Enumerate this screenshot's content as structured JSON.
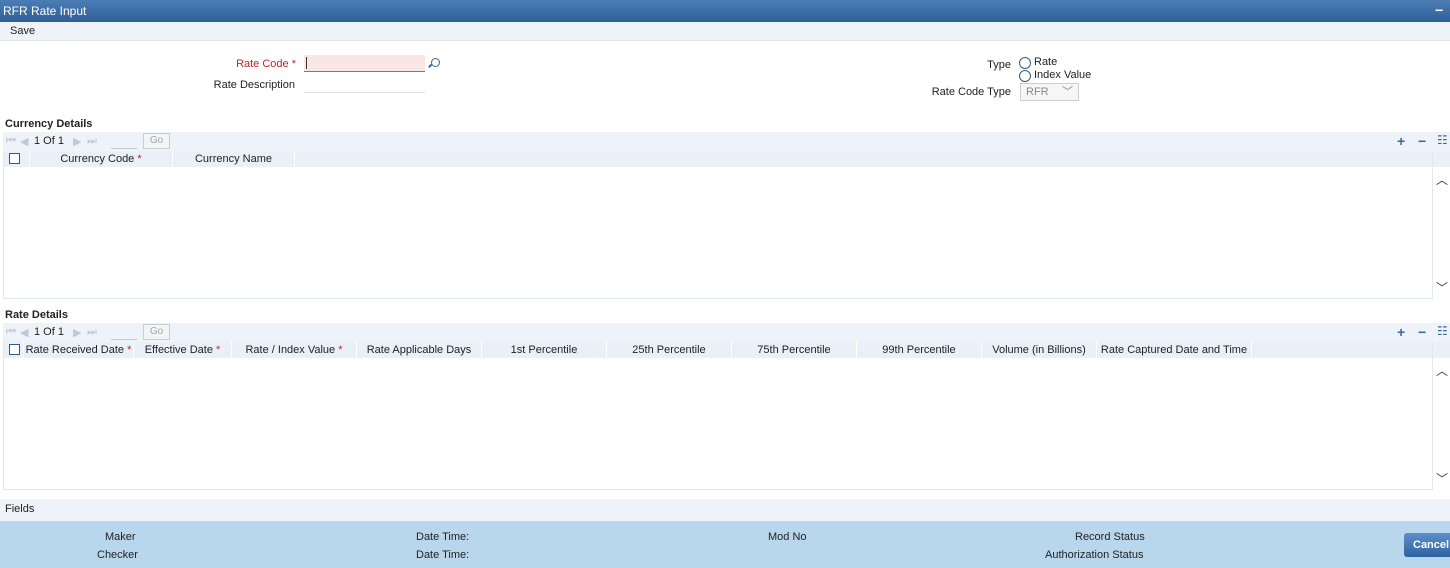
{
  "window": {
    "title": "RFR Rate Input",
    "minimize_glyph": "−"
  },
  "toolbar": {
    "save_label": "Save"
  },
  "form": {
    "rate_code_label": "Rate Code",
    "required_mark": "*",
    "rate_code_value": "",
    "rate_description_label": "Rate Description",
    "rate_description_value": "",
    "type_label": "Type",
    "type_options": [
      "Rate",
      "Index Value"
    ],
    "rate_code_type_label": "Rate Code Type",
    "rate_code_type_value": "RFR"
  },
  "currency_details": {
    "title": "Currency Details",
    "pager": {
      "text": "1 Of 1",
      "go_label": "Go"
    },
    "columns": [
      "Currency Code",
      "Currency Name"
    ],
    "rows": []
  },
  "rate_details": {
    "title": "Rate Details",
    "pager": {
      "text": "1 Of 1",
      "go_label": "Go"
    },
    "columns": [
      "Rate Received Date",
      "Effective Date",
      "Rate / Index Value",
      "Rate Applicable Days",
      "1st Percentile",
      "25th Percentile",
      "75th Percentile",
      "99th Percentile",
      "Volume (in Billions)",
      "Rate Captured Date and Time"
    ],
    "rows": []
  },
  "fields_bar": {
    "label": "Fields"
  },
  "audit": {
    "maker_label": "Maker",
    "checker_label": "Checker",
    "date_time_label": "Date Time:",
    "mod_no_label": "Mod No",
    "record_status_label": "Record Status",
    "authorization_status_label": "Authorization Status"
  },
  "buttons": {
    "cancel_label": "Cancel"
  },
  "icons": {
    "add": "+",
    "remove": "−",
    "single_view": "☷",
    "nav_first": "⏮",
    "nav_prev": "◀",
    "nav_next": "▶",
    "nav_last": "⏭",
    "scroll_up": "︿",
    "scroll_down": "﹀",
    "dropdown": "﹀"
  }
}
